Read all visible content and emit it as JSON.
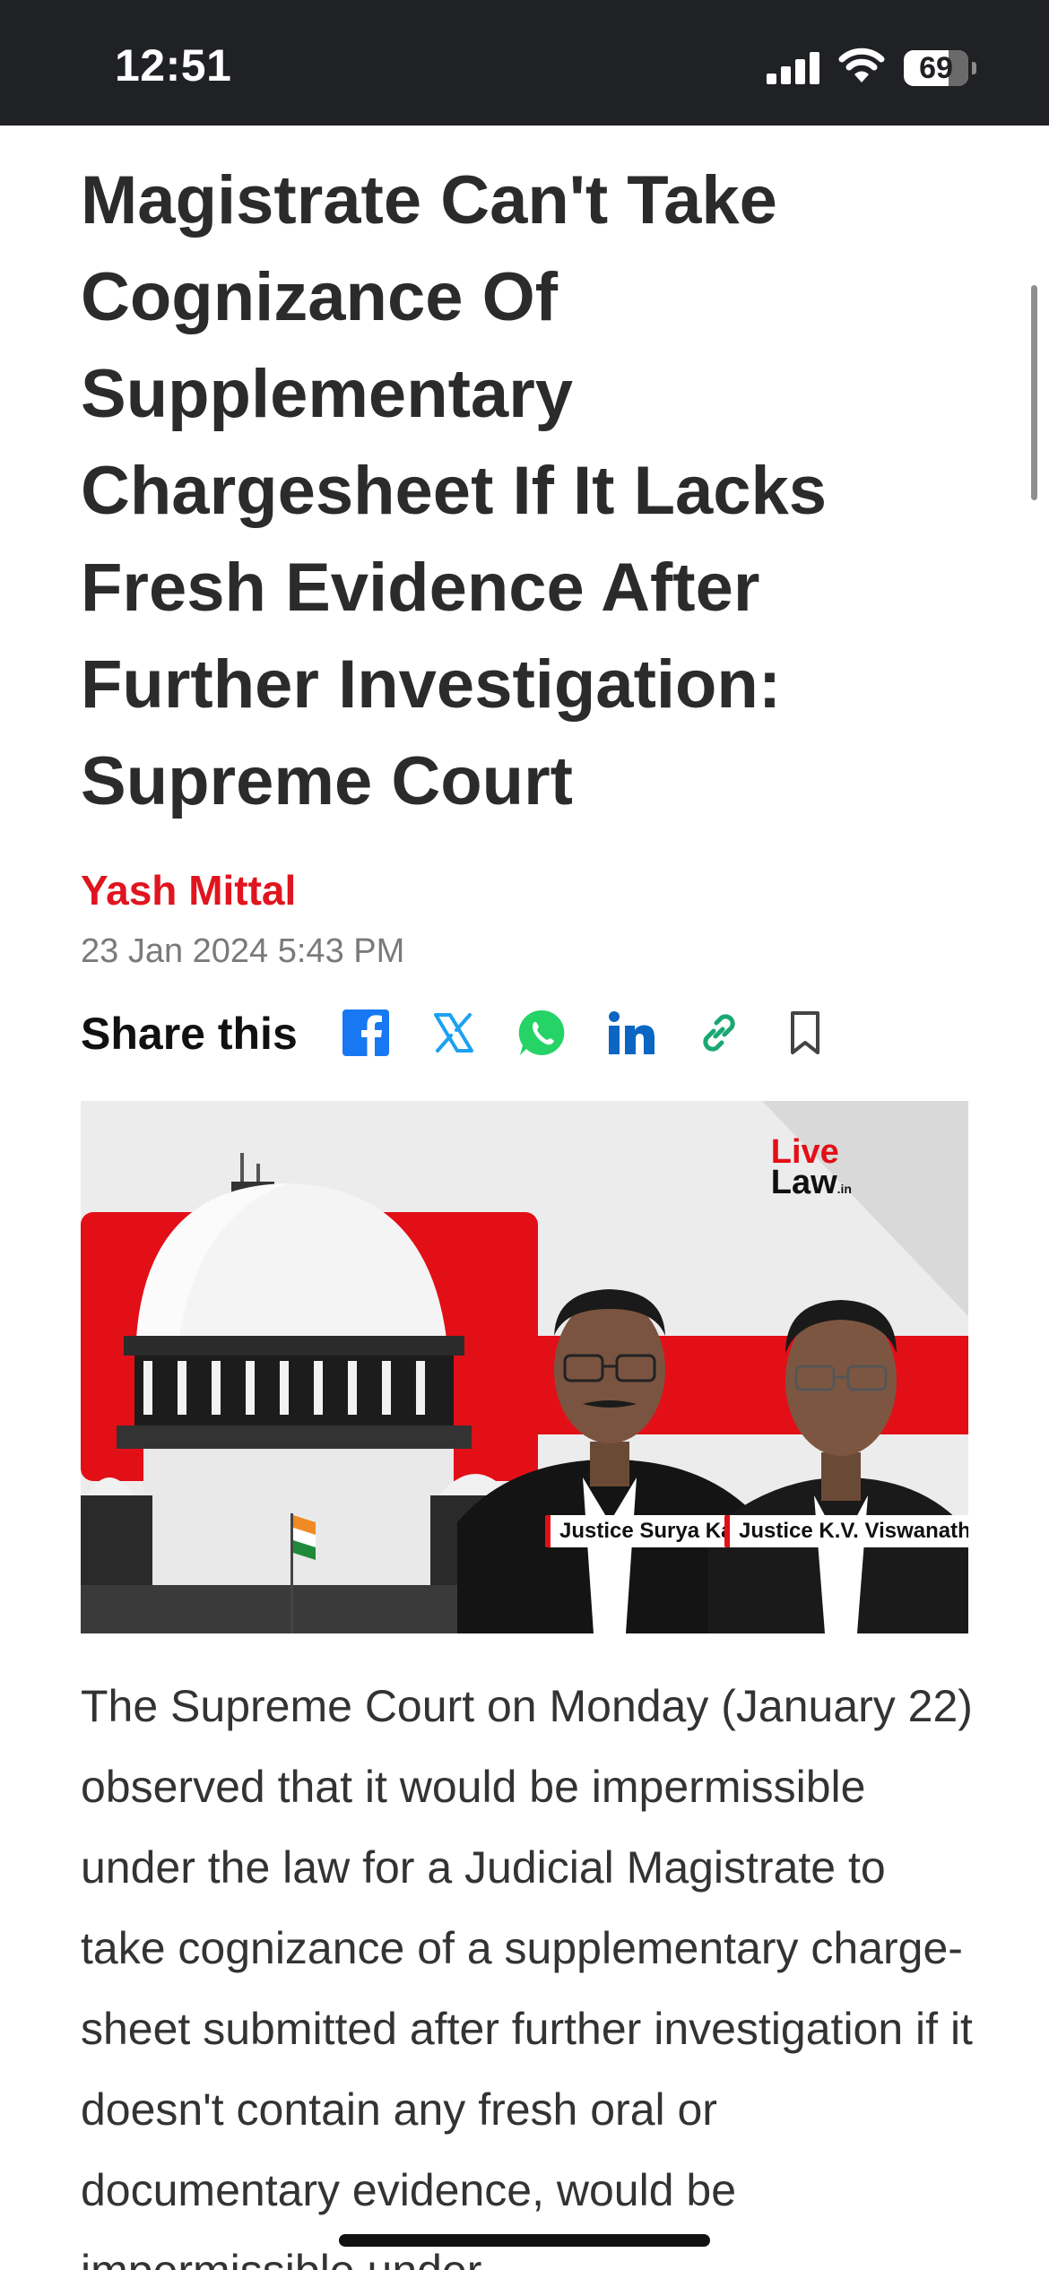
{
  "status_bar": {
    "time": "12:51",
    "battery_level": "69",
    "battery_fraction": 0.69,
    "signal_icon": "cellular-signal-icon",
    "wifi_icon": "wifi-icon"
  },
  "article": {
    "headline": "Magistrate Can't Take Cognizance Of Supplementary Chargesheet If It Lacks Fresh Evidence After Further Investigation: Supreme Court",
    "author": "Yash Mittal",
    "date": "23 Jan 2024 5:43 PM",
    "share_label": "Share this",
    "share_icons": [
      "facebook-icon",
      "x-icon",
      "whatsapp-icon",
      "linkedin-icon",
      "copy-link-icon",
      "bookmark-icon"
    ],
    "hero_image": {
      "logo_top": "Live",
      "logo_bottom": "Law",
      "logo_suffix": ".in",
      "judge_1": "Justice Surya Kant",
      "judge_2": "Justice K.V. Viswanathan"
    },
    "body": "The Supreme Court on Monday (January 22) observed that it would be impermissible under the law for a Judicial Magistrate to take cognizance of a supplementary charge-sheet submitted after further investigation if it doesn't contain any fresh oral or documentary evidence, would be impermissible under"
  },
  "colors": {
    "status_bar_bg": "#202124",
    "author": "#e0151f",
    "facebook": "#1877f2",
    "x": "#1da1f2",
    "whatsapp": "#25d366",
    "linkedin": "#0a66c2",
    "link": "#1aa872",
    "hero_red": "#e30f17"
  }
}
